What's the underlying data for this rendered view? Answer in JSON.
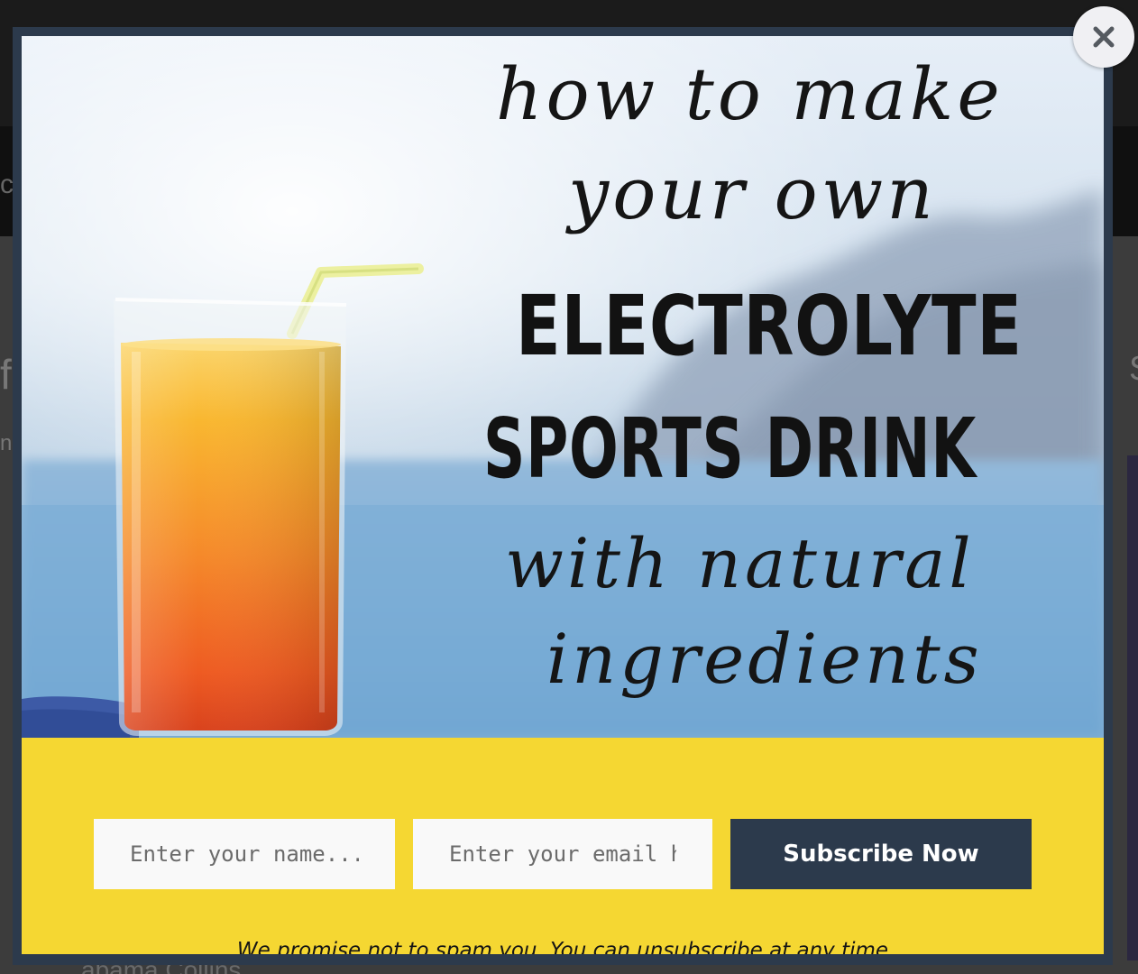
{
  "background": {
    "fragments": [
      "c",
      "fi",
      "S",
      "ng",
      "abama Collins"
    ]
  },
  "modal": {
    "close_icon": "close-icon",
    "hero": {
      "lines": [
        "how to make",
        "your own",
        "ELECTROLYTE",
        "SPORTS DRINK",
        "with natural",
        "ingredients"
      ],
      "image": "orange-drink-glass-by-sea"
    },
    "form": {
      "name_placeholder": "Enter your name...",
      "email_placeholder": "Enter your email here",
      "subscribe_label": "Subscribe Now",
      "disclaimer": "We promise not to spam you. You can unsubscribe at any time"
    },
    "colors": {
      "band": "#f5d732",
      "button": "#2c3a4c",
      "frame": "#2c3a4c"
    }
  }
}
